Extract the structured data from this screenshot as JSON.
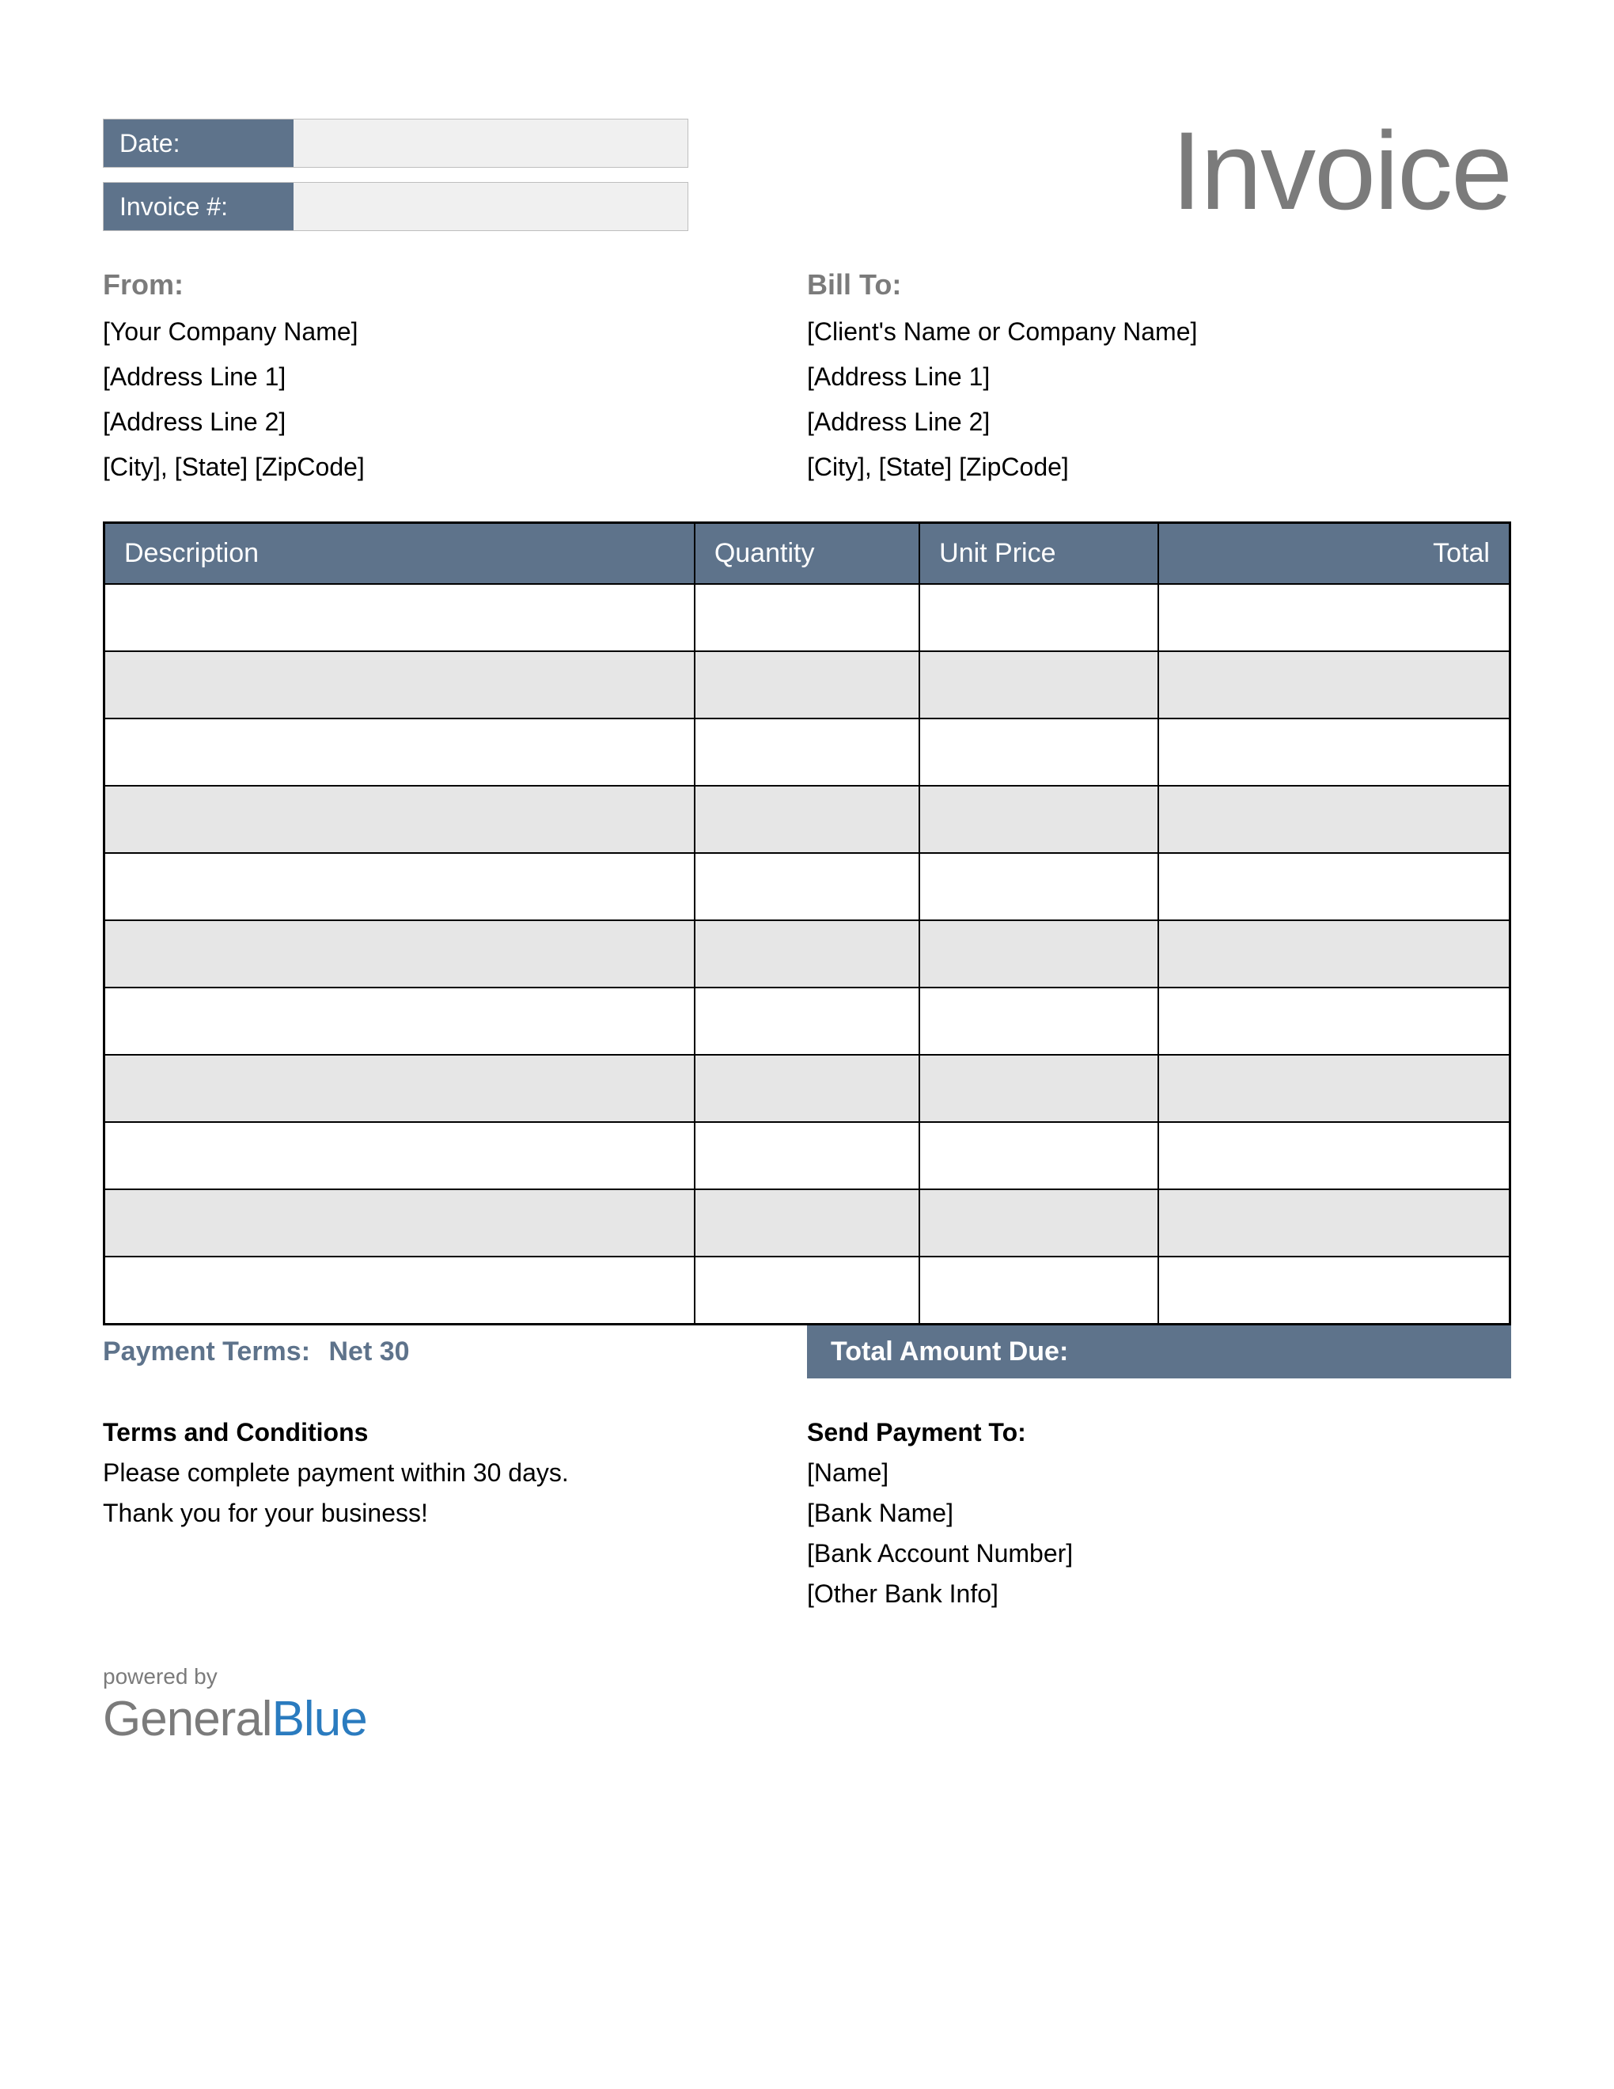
{
  "meta": {
    "date_label": "Date:",
    "date_value": "",
    "invoice_num_label": "Invoice #:",
    "invoice_num_value": ""
  },
  "title": "Invoice",
  "from": {
    "heading": "From:",
    "lines": [
      "[Your Company Name]",
      "[Address Line 1]",
      "[Address Line 2]",
      "[City], [State] [ZipCode]"
    ]
  },
  "bill_to": {
    "heading": "Bill To:",
    "lines": [
      "[Client's Name or Company Name]",
      "[Address Line 1]",
      "[Address Line 2]",
      "[City], [State] [ZipCode]"
    ]
  },
  "table": {
    "headers": [
      "Description",
      "Quantity",
      "Unit Price",
      "Total"
    ],
    "rows": [
      {
        "description": "",
        "quantity": "",
        "unit_price": "",
        "total": ""
      },
      {
        "description": "",
        "quantity": "",
        "unit_price": "",
        "total": ""
      },
      {
        "description": "",
        "quantity": "",
        "unit_price": "",
        "total": ""
      },
      {
        "description": "",
        "quantity": "",
        "unit_price": "",
        "total": ""
      },
      {
        "description": "",
        "quantity": "",
        "unit_price": "",
        "total": ""
      },
      {
        "description": "",
        "quantity": "",
        "unit_price": "",
        "total": ""
      },
      {
        "description": "",
        "quantity": "",
        "unit_price": "",
        "total": ""
      },
      {
        "description": "",
        "quantity": "",
        "unit_price": "",
        "total": ""
      },
      {
        "description": "",
        "quantity": "",
        "unit_price": "",
        "total": ""
      },
      {
        "description": "",
        "quantity": "",
        "unit_price": "",
        "total": ""
      },
      {
        "description": "",
        "quantity": "",
        "unit_price": "",
        "total": ""
      }
    ]
  },
  "payment_terms": {
    "label": "Payment Terms:",
    "value": "Net 30"
  },
  "total_due": {
    "label": "Total Amount Due:",
    "value": ""
  },
  "terms": {
    "heading": "Terms and Conditions",
    "lines": [
      "Please complete payment within 30 days.",
      "Thank you for your business!"
    ]
  },
  "send_to": {
    "heading": "Send Payment To:",
    "lines": [
      "[Name]",
      "[Bank Name]",
      "[Bank Account Number]",
      "[Other Bank Info]"
    ]
  },
  "powered": {
    "small": "powered by",
    "brand_a": "General",
    "brand_b": "Blue"
  }
}
